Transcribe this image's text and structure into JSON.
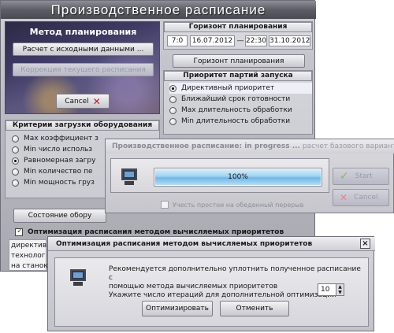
{
  "main": {
    "title": "Производственное расписание",
    "planning_method": {
      "title": "Метод планирования",
      "calc_button": "Расчет с исходными данными ...",
      "correct_button": "Коррекция текущего расписания",
      "cancel_button": "Cancel"
    },
    "horizon": {
      "title": "Горизонт планирования",
      "start_time": "7:0",
      "start_date": "16.07.2012",
      "separator": "—",
      "end_time": "22:30",
      "end_date": "31.10.2012",
      "button": "Горизонт планирования"
    },
    "batch_priority": {
      "title": "Приоритет партий запуска",
      "options": [
        {
          "label": "Директивный приоритет",
          "checked": true
        },
        {
          "label": "Ближайший срок готовности",
          "checked": false
        },
        {
          "label": "Max длительность обработки",
          "checked": false
        },
        {
          "label": "Min длительность обработки",
          "checked": false
        }
      ]
    },
    "load_criteria": {
      "title": "Критерии загрузки оборудования",
      "options": [
        {
          "label": "Max коэффициент з",
          "checked": false
        },
        {
          "label": "Min число использ",
          "checked": false
        },
        {
          "label": "Равномерная загру",
          "checked": true
        },
        {
          "label": "Min  количество пе",
          "checked": false
        },
        {
          "label": "Min мощность груз",
          "checked": false
        }
      ]
    },
    "state_button": "Состояние обору",
    "optimization_checkbox": "Оптимизация расписания методом вычисляемых приоритетов",
    "bottom_lines": [
      "директив",
      "технолог",
      "на станок"
    ]
  },
  "progress": {
    "title_bold": "Производственное расписание: in progress ...",
    "title_rest": " расчет базового варианта",
    "percent": 100,
    "percent_label": "100%",
    "start_button": "Start",
    "cancel_button": "Cancel",
    "lunch_checkbox": "Учесть простои на обеденный перерыв"
  },
  "optimize_dialog": {
    "title": "Оптимизация расписания методом вычисляемых приоритетов",
    "close": "×",
    "message_line1": "Рекомендуется дополнительно уплотнить полученное расписание с",
    "message_line2": "помощью метода вычисляемых приоритетов",
    "message_line3": "Укажите число итераций для дополнительной оптимизации",
    "iterations": "10",
    "optimize_button": "Оптимизировать",
    "cancel_button": "Отменить"
  },
  "colors": {
    "title_bar": "#5d5d66",
    "progress_fill": "#70b7e6",
    "cancel_x": "#c81818",
    "start_check": "#5aa83a"
  },
  "icons": [
    "monitor-icon",
    "cancel-x-icon",
    "check-icon",
    "close-icon",
    "spin-up-icon",
    "spin-down-icon"
  ]
}
